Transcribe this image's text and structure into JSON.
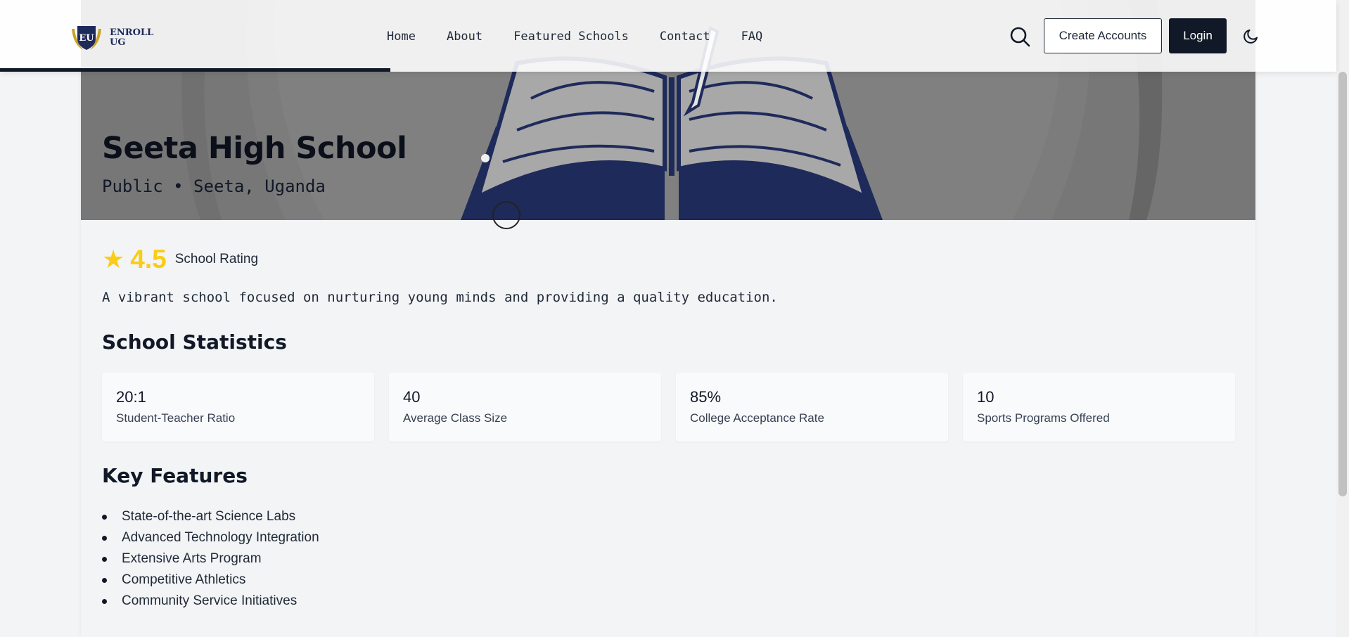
{
  "header": {
    "logo_line1": "ENROLL",
    "logo_line2": "UG",
    "logo_mark": "EU",
    "nav": [
      "Home",
      "About",
      "Featured Schools",
      "Contact",
      "FAQ"
    ],
    "search_icon": "search-icon",
    "create_label": "Create Accounts",
    "login_label": "Login",
    "theme_icon": "moon-icon"
  },
  "hero": {
    "title": "Seeta High School",
    "subtitle": "Public • Seeta, Uganda"
  },
  "rating": {
    "value": "4.5",
    "label": "School Rating",
    "star_icon": "star-icon",
    "color": "#facc15"
  },
  "description": "A vibrant school focused on nurturing young minds and providing a quality education.",
  "statistics": {
    "title": "School Statistics",
    "items": [
      {
        "value": "20:1",
        "label": "Student-Teacher Ratio"
      },
      {
        "value": "40",
        "label": "Average Class Size"
      },
      {
        "value": "85%",
        "label": "College Acceptance Rate"
      },
      {
        "value": "10",
        "label": "Sports Programs Offered"
      }
    ]
  },
  "features": {
    "title": "Key Features",
    "items": [
      "State-of-the-art Science Labs",
      "Advanced Technology Integration",
      "Extensive Arts Program",
      "Competitive Athletics",
      "Community Service Initiatives"
    ]
  },
  "colors": {
    "primary": "#111827",
    "accent": "#facc15",
    "hero_navy": "#1e2a5a"
  }
}
